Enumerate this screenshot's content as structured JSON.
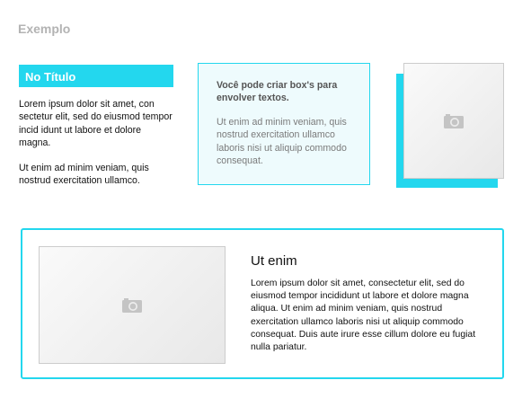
{
  "page": {
    "title": "Exemplo"
  },
  "column1": {
    "heading": "No Título",
    "paragraphs": [
      "Lorem ipsum dolor sit amet, con sectetur  elit, sed do eiusmod tempor incid idunt ut  labore et dolore magna.",
      "Ut enim ad minim veniam, quis nostrud exercitation ullamco."
    ]
  },
  "info_box": {
    "title": "Você pode criar box's para envolver textos.",
    "body": "Ut enim ad minim veniam, quis nostrud exercitation ullamco laboris nisi ut aliquip commodo consequat."
  },
  "feature": {
    "title": "Ut enim",
    "body": "Lorem ipsum dolor sit amet, consectetur  elit, sed do eiusmod tempor incididunt ut  labore et dolore magna aliqua. Ut enim ad minim veniam, quis nostrud exercitation ullamco laboris nisi ut aliquip commodo consequat. Duis aute irure esse cillum dolore eu fugiat nulla pariatur."
  },
  "icons": {
    "image_placeholder": "camera-icon"
  },
  "colors": {
    "accent": "#23d7ee",
    "info_box_background": "#eefbfd",
    "title_gray": "#b3b3b3"
  }
}
